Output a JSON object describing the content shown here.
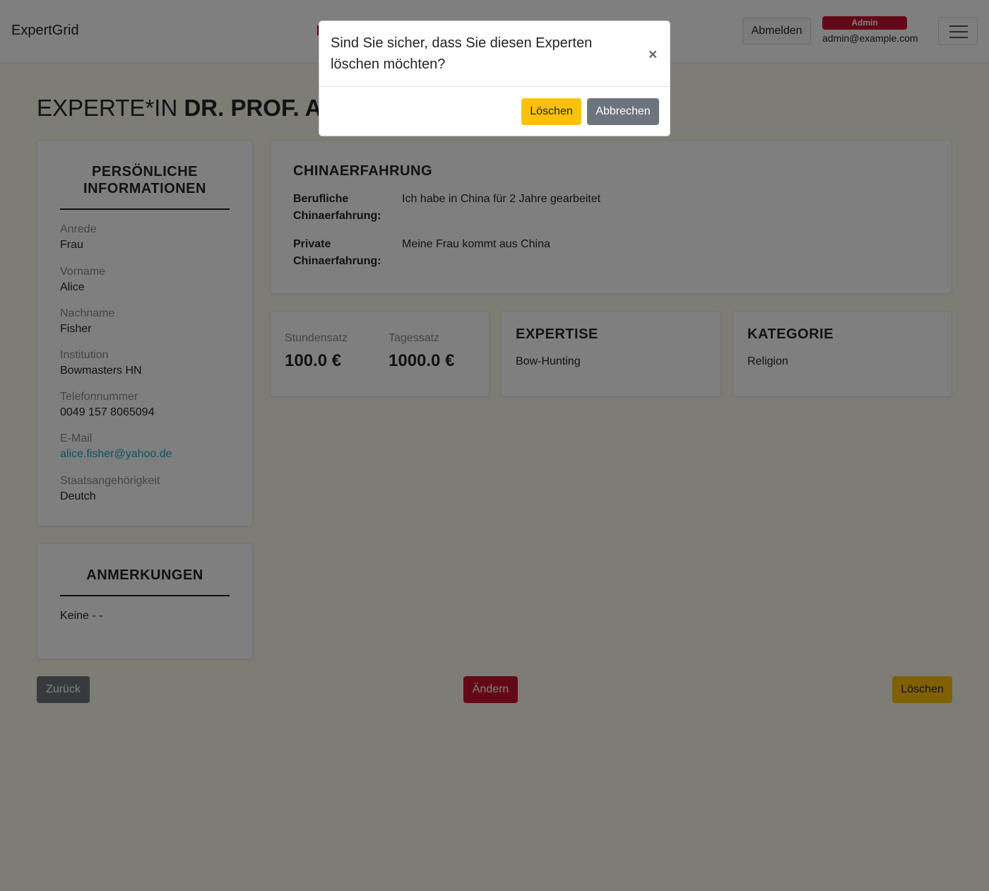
{
  "navbar": {
    "brand": "ExpertGrid",
    "logout_label": "Abmelden",
    "role_badge": "Admin",
    "user_email": "admin@example.com"
  },
  "page": {
    "title_prefix": "EXPERTE*IN",
    "title_name": "DR. PROF. AL"
  },
  "personal": {
    "heading": "PERSÖNLICHE INFORMATIONEN",
    "fields": [
      {
        "label": "Anrede",
        "value": "Frau"
      },
      {
        "label": "Vorname",
        "value": "Alice"
      },
      {
        "label": "Nachname",
        "value": "Fisher"
      },
      {
        "label": "Institution",
        "value": "Bowmasters HN"
      },
      {
        "label": "Telefonnummer",
        "value": "0049 157 8065094"
      },
      {
        "label": "E-Mail",
        "value": "alice.fisher@yahoo.de"
      },
      {
        "label": "Staatsangehörigkeit",
        "value": "Deutch"
      }
    ]
  },
  "notes": {
    "heading": "ANMERKUNGEN",
    "text": "Keine - -"
  },
  "china": {
    "heading": "CHINAERFAHRUNG",
    "professional_label": "Berufliche Chinaerfahrung:",
    "professional_value": "Ich habe in China für 2 Jahre gearbeitet",
    "private_label": "Private Chinaerfahrung:",
    "private_value": "Meine Frau kommt aus China"
  },
  "rates": {
    "hourly_label": "Stundensatz",
    "hourly_value": "100.0 €",
    "daily_label": "Tagessatz",
    "daily_value": "1000.0 €"
  },
  "expertise": {
    "heading": "EXPERTISE",
    "value": "Bow-Hunting"
  },
  "category": {
    "heading": "KATEGORIE",
    "value": "Religion"
  },
  "actions": {
    "back_label": "Zurück",
    "edit_label": "Ändern",
    "delete_label": "Löschen"
  },
  "modal": {
    "title": "Sind Sie sicher, dass Sie diesen Experten löschen möchten?",
    "close_symbol": "×",
    "confirm_label": "Löschen",
    "cancel_label": "Abbrechen"
  },
  "colors": {
    "primary_red": "#c8102e",
    "warning_yellow": "#ffc107",
    "secondary_gray": "#6c757d",
    "link_blue": "#1aa2c8",
    "page_background": "#fbf9ea"
  }
}
